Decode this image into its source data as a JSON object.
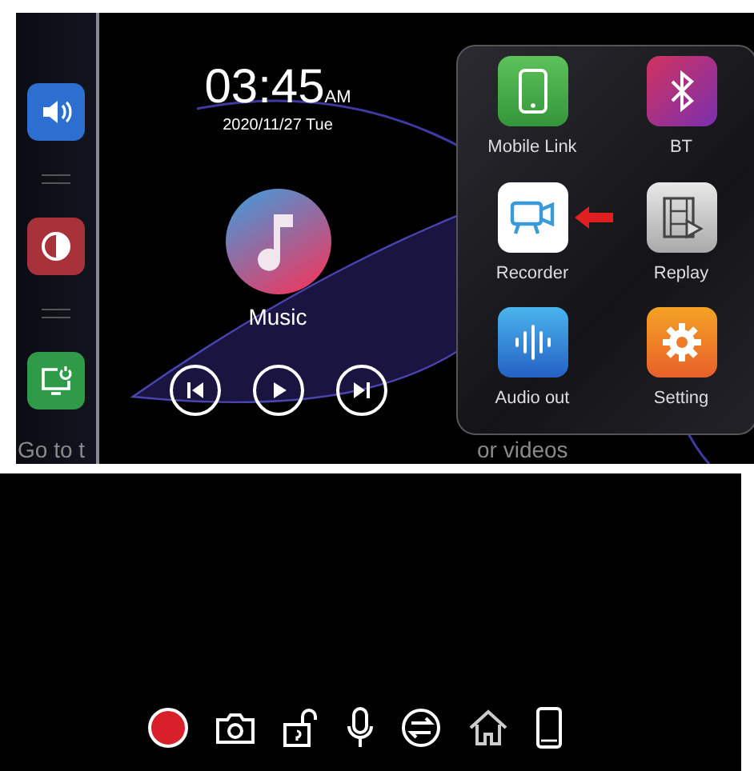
{
  "sidebar": {
    "buttons": [
      {
        "kind": "volume"
      },
      {
        "kind": "brightness"
      },
      {
        "kind": "screen"
      }
    ]
  },
  "clock": {
    "time": "03:45",
    "meridiem": "AM",
    "date": "2020/11/27 Tue"
  },
  "music": {
    "label": "Music"
  },
  "apps": [
    {
      "label": "Mobile Link",
      "kind": "phone",
      "selected": false
    },
    {
      "label": "BT",
      "kind": "bluetooth",
      "selected": false
    },
    {
      "label": "Recorder",
      "kind": "recorder",
      "selected": true
    },
    {
      "label": "Replay",
      "kind": "replay",
      "selected": false
    },
    {
      "label": "Audio out",
      "kind": "audio",
      "selected": false
    },
    {
      "label": "Setting",
      "kind": "setting",
      "selected": false
    }
  ],
  "caption_fragments": [
    "Go to t",
    "or videos"
  ]
}
